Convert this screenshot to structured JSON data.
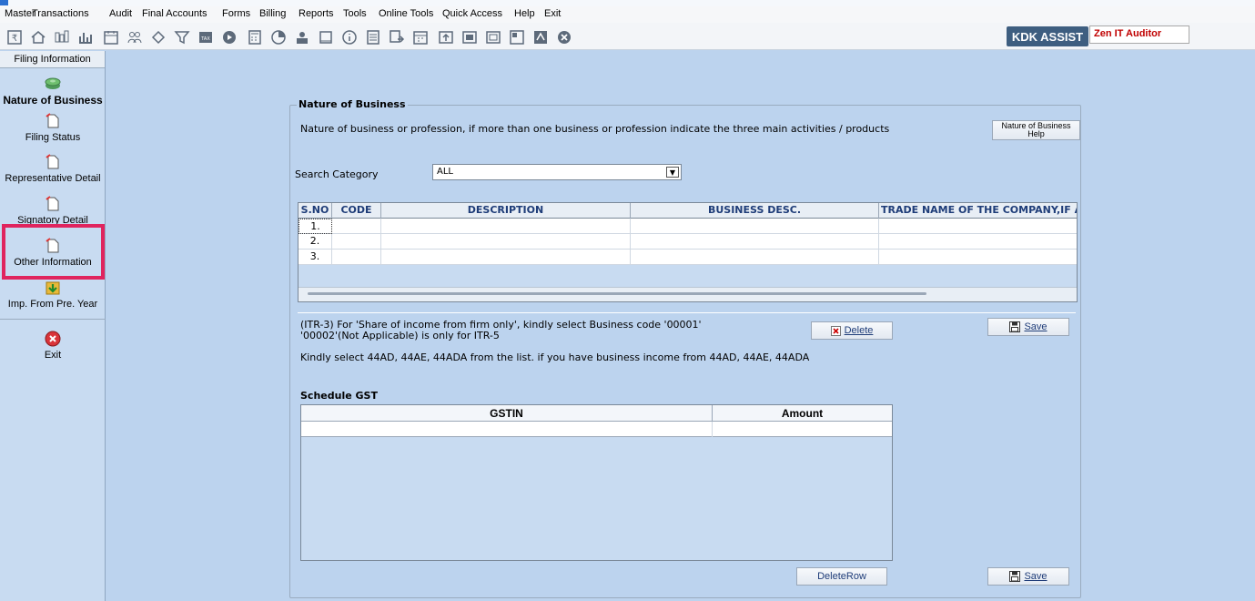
{
  "menu": [
    "Master",
    "Transactions",
    "Audit",
    "Final Accounts",
    "Forms",
    "Billing",
    "Reports",
    "Tools",
    "Online Tools",
    "Quick Access",
    "Help",
    "Exit"
  ],
  "header": {
    "kdk_assist": "KDK ASSIST",
    "zen_label": "Zen IT Auditor"
  },
  "sidebar": {
    "title": "Filing Information",
    "items": [
      {
        "label": "Nature of Business",
        "icon": "money-stack-icon"
      },
      {
        "label": "Filing Status",
        "icon": "document-icon"
      },
      {
        "label": "Representative Detail",
        "icon": "document-icon"
      },
      {
        "label": "Signatory Detail",
        "icon": "document-icon"
      },
      {
        "label": "Other Information",
        "icon": "document-icon"
      },
      {
        "label": "Imp. From Pre. Year",
        "icon": "import-icon"
      },
      {
        "label": "Exit",
        "icon": "close-circle-icon"
      }
    ]
  },
  "panel": {
    "legend": "Nature of Business",
    "instruction": "Nature of business or profession, if more than one business or profession indicate the three main activities / products",
    "help_button_line1": "Nature of Business",
    "help_button_line2": "Help",
    "search_label": "Search Category",
    "search_value": "ALL",
    "table": {
      "headers": [
        "S.NO",
        "CODE",
        "DESCRIPTION",
        "BUSINESS DESC.",
        "TRADE NAME OF THE COMPANY,IF AN"
      ],
      "rows": [
        "1.",
        "2.",
        "3."
      ]
    },
    "note_line1": "(ITR-3) For 'Share of income from firm only', kindly select Business code '00001'",
    "note_line2": "'00002'(Not Applicable) is only for ITR-5",
    "note_line3": "Kindly select 44AD, 44AE, 44ADA from the list. if you have business income from 44AD, 44AE, 44ADA",
    "delete_label": "Delete",
    "save_label": "Save",
    "gst": {
      "title": "Schedule GST",
      "headers": [
        "GSTIN",
        "Amount"
      ]
    },
    "delete_row_label": "DeleteRow",
    "save2_label": "Save"
  },
  "colors": {
    "background": "#bcd3ee",
    "accent": "#3e5e80",
    "highlight": "#e0245e"
  }
}
